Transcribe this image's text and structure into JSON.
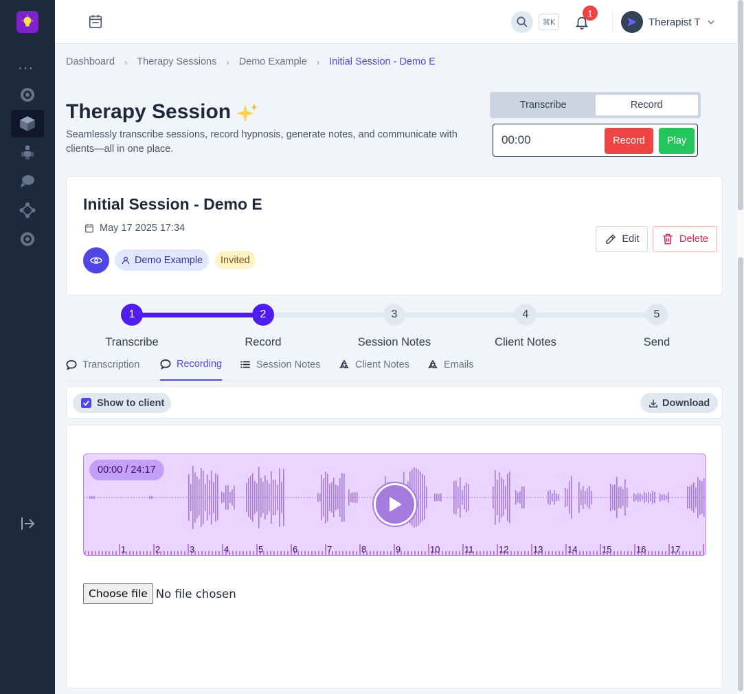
{
  "topbar": {
    "kbd_hint": "⌘K",
    "notification_count": "1",
    "user_name": "Therapist T"
  },
  "breadcrumb": [
    "Dashboard",
    "Therapy Sessions",
    "Demo Example",
    "Initial Session - Demo E"
  ],
  "header": {
    "title": "Therapy Session",
    "subtitle": "Seamlessly transcribe sessions, record hypnosis, generate notes, and communicate with clients—all in one place."
  },
  "mode_toggle": {
    "tabs": [
      "Transcribe",
      "Record"
    ],
    "active": "Record"
  },
  "recorder": {
    "time": "00:00",
    "record_label": "Record",
    "play_label": "Play"
  },
  "session": {
    "title": "Initial Session - Demo E",
    "date": "May 17 2025 17:34",
    "client": "Demo Example",
    "status": "Invited",
    "edit_label": "Edit",
    "delete_label": "Delete"
  },
  "stepper": {
    "current_step": 2,
    "steps": [
      {
        "number": "1",
        "label": "Transcribe"
      },
      {
        "number": "2",
        "label": "Record"
      },
      {
        "number": "3",
        "label": "Session Notes"
      },
      {
        "number": "4",
        "label": "Client Notes"
      },
      {
        "number": "5",
        "label": "Send"
      }
    ]
  },
  "tabs": {
    "items": [
      "Transcription",
      "Recording",
      "Session Notes",
      "Client Notes",
      "Emails"
    ],
    "active": "Recording"
  },
  "recording_toolbar": {
    "show_to_client_label": "Show to client",
    "show_to_client_checked": true,
    "download_label": "Download"
  },
  "player": {
    "time": "00:00 / 24:17",
    "timeline_labels": [
      "1",
      "2",
      "3",
      "4",
      "5",
      "6",
      "7",
      "8",
      "9",
      "10",
      "11",
      "12",
      "13",
      "14",
      "15",
      "16",
      "17",
      "1"
    ]
  },
  "file_input": {
    "button_label": "Choose file",
    "status": "No file chosen"
  },
  "colors": {
    "accent": "#4f46e5",
    "stepper": "#4f1df0",
    "record_red": "#ef4444",
    "play_green": "#22c55e",
    "waveform_bg": "#e9d5ff",
    "waveform_bars": "#a67bdf"
  }
}
